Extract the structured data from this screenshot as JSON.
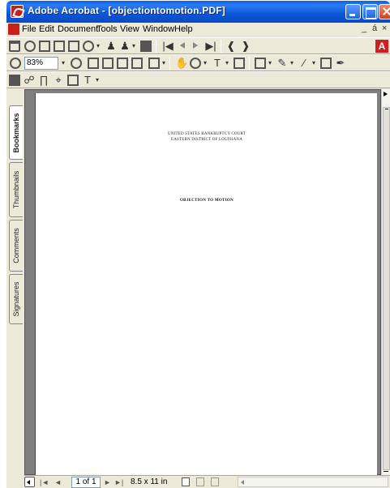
{
  "window": {
    "title": "Adobe Acrobat - [objectiontomotion.PDF]"
  },
  "menubar": {
    "items": [
      "File",
      "Edit",
      "Document",
      "Tools",
      "View",
      "Window",
      "Help"
    ],
    "mdi_min": "_",
    "mdi_restore": "á",
    "mdi_close": "×"
  },
  "toolbar": {
    "zoom_value": "83%",
    "dropdown_glyph": "▾"
  },
  "side_tabs": [
    "Bookmarks",
    "Thumbnails",
    "Comments",
    "Signatures"
  ],
  "document": {
    "court_line1": "UNITED STATES BANKRUPTCY COURT",
    "court_line2": "EASTERN DISTRICT OF LOUISIANA",
    "title": "OBJECTION TO MOTION"
  },
  "statusbar": {
    "page_indicator": "1 of 1",
    "page_size": "8.5 x 11 in",
    "nav_prev": "◄",
    "nav_first": "|◄",
    "nav_next": "►",
    "nav_last": "►|"
  },
  "colors": {
    "titlebar": "#0a5fe8",
    "chrome": "#ece9d8",
    "viewer_bg": "#7f7f7f",
    "close_button": "#d1431c",
    "adobe_red": "#d1201c"
  }
}
